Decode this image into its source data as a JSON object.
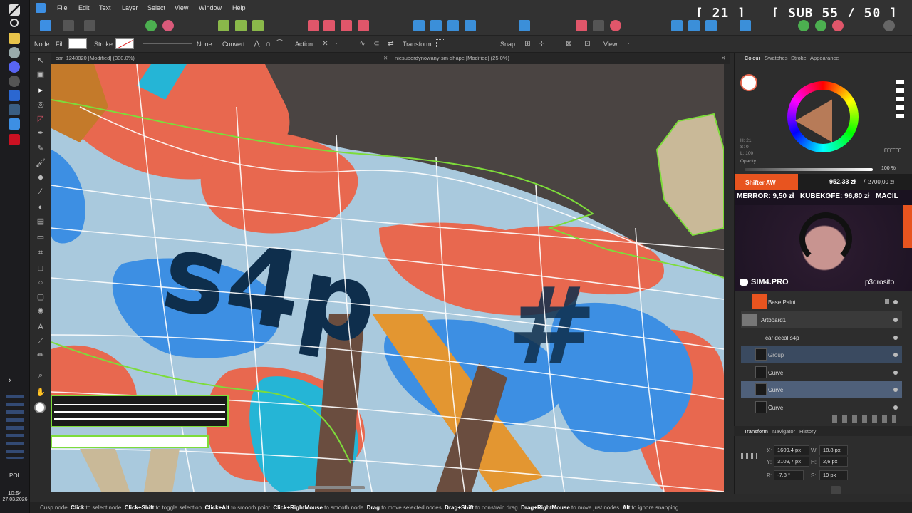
{
  "app": {
    "menu": [
      "File",
      "Edit",
      "Text",
      "Layer",
      "Select",
      "View",
      "Window",
      "Help"
    ]
  },
  "stream_overlay": {
    "count": "[ 21 ]",
    "sub": "[ SUB 55 / 50 ]",
    "donation_name": "Shifter AW",
    "donation_amount": "952,33 zł",
    "donation_goal": "2700,00 zł",
    "ticker": "MERROR: 9,50 zł   KUBEKGFE: 96,80 zł   MACIL",
    "discord": "SIM4.PRO",
    "streamer": "p3drosito"
  },
  "context_toolbar": {
    "node_label": "Node",
    "fill_label": "Fill:",
    "stroke_label": "Stroke:",
    "stroke_value": "None",
    "convert_label": "Convert:",
    "action_label": "Action:",
    "transform_label": "Transform:",
    "snap_label": "Snap:",
    "view_label": "View:"
  },
  "tabs": [
    {
      "label": "car_1248820 [Modified] (300.0%)"
    },
    {
      "label": "niesubordynowany-sm-shape [Modified] (25.0%)"
    }
  ],
  "panel_tabs": [
    "Colour",
    "Swatches",
    "Stroke",
    "Appearance"
  ],
  "colour": {
    "h": "H: 21",
    "s": "S: 0",
    "l": "L: 100",
    "hex": "FFFFFF",
    "opacity_label": "Opacity",
    "opacity_value": "100 %"
  },
  "layers": [
    {
      "name": "Base Paint"
    },
    {
      "name": "Artboard1"
    },
    {
      "name": "car decal s4p"
    },
    {
      "name": "Group"
    },
    {
      "name": "Curve"
    },
    {
      "name": "Curve"
    },
    {
      "name": "Curve"
    }
  ],
  "bottom_tabs": [
    "Transform",
    "Navigator",
    "History"
  ],
  "transform": {
    "x_label": "X:",
    "x": "1609,4 px",
    "y_label": "Y:",
    "y": "3109,7 px",
    "w_label": "W:",
    "w": "18,8 px",
    "h_label": "H:",
    "h": "2,6 px",
    "r_label": "R:",
    "r": "-7,8 °",
    "s_label": "S:",
    "s": "19 px"
  },
  "status": {
    "prefix": "Cusp node.",
    "parts": [
      {
        "b": "Click",
        "t": " to select node. "
      },
      {
        "b": "Click+Shift",
        "t": " to toggle selection. "
      },
      {
        "b": "Click+Alt",
        "t": " to smooth point. "
      },
      {
        "b": "Click+RightMouse",
        "t": " to smooth node. "
      },
      {
        "b": "Drag",
        "t": " to move selected nodes. "
      },
      {
        "b": "Drag+Shift",
        "t": " to constrain drag. "
      },
      {
        "b": "Drag+RightMouse",
        "t": " to move just nodes. "
      },
      {
        "b": "Alt",
        "t": " to ignore snapping."
      }
    ]
  },
  "system": {
    "lang": "POL",
    "time": "10:54",
    "date": "27.03.2026"
  },
  "colors": {
    "accent": "#3b8fd9",
    "salmon": "#e8684f",
    "lightblue": "#a9c9dd",
    "blue": "#3d8fe3",
    "cyan": "#25b5d6",
    "brown": "#6a4d3f",
    "orange": "#e39631",
    "navy": "#0e2e4c"
  }
}
